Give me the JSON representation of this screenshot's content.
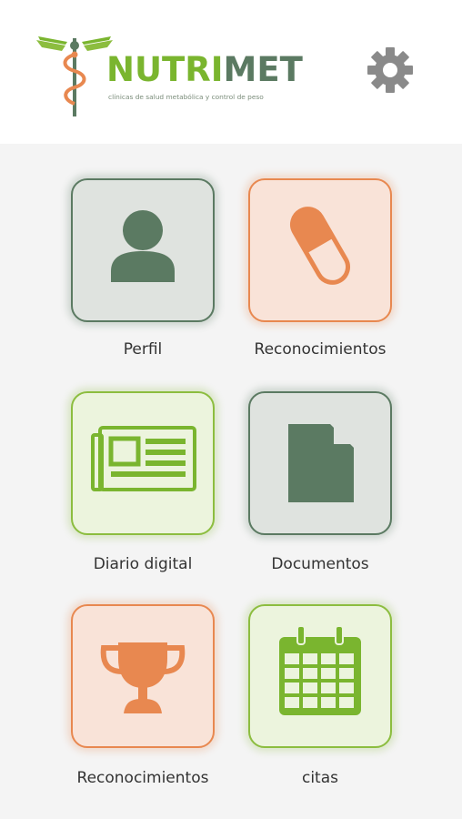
{
  "header": {
    "brand_part1": "NUTRI",
    "brand_part2": "MET",
    "tagline": "clínicas de salud metabólica y control de peso",
    "settings_icon": "gear-icon"
  },
  "tiles": [
    {
      "label": "Perfil",
      "icon": "user-icon"
    },
    {
      "label": "Reconocimientos",
      "icon": "pill-icon"
    },
    {
      "label": "Diario digital",
      "icon": "newspaper-icon"
    },
    {
      "label": "Documentos",
      "icon": "document-icon"
    },
    {
      "label": "Reconocimientos",
      "icon": "trophy-icon"
    },
    {
      "label": "citas",
      "icon": "calendar-icon"
    }
  ],
  "colors": {
    "brand_green": "#7ab52f",
    "brand_dark": "#5b7a62",
    "accent_orange": "#e88850",
    "settings_gray": "#8a8a8a"
  }
}
